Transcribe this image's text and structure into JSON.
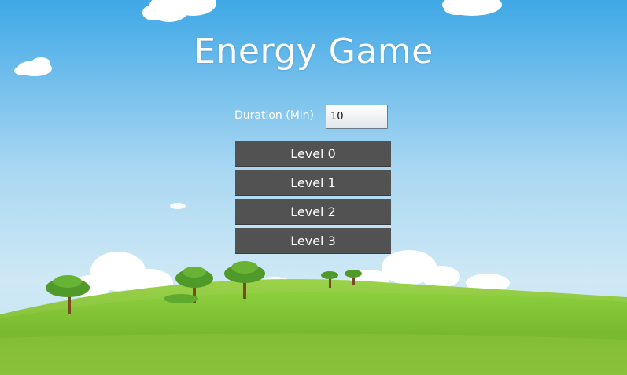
{
  "title": "Energy Game",
  "duration": {
    "label": "Duration (Min)",
    "value": "10"
  },
  "levels": [
    {
      "label": "Level 0"
    },
    {
      "label": "Level 1"
    },
    {
      "label": "Level 2"
    },
    {
      "label": "Level 3"
    }
  ],
  "colors": {
    "sky_top": "#3fa8e6",
    "sky_bottom": "#bfe4f3",
    "grass": "#8cc63f",
    "button": "#525252"
  }
}
